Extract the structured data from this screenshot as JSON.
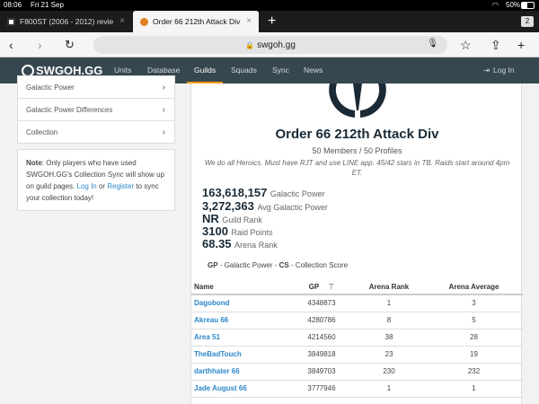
{
  "status": {
    "time": "08:06",
    "date": "Fri 21 Sep",
    "battery": "50%"
  },
  "tabs": [
    {
      "label": "F800ST (2006 - 2012) revie",
      "close": "×"
    },
    {
      "label": "Order 66 212th Attack Div",
      "close": "×"
    }
  ],
  "tab_count": "2",
  "new_tab": "+",
  "url": "swgoh.gg",
  "site": {
    "logo": "SWGOH.GG",
    "nav": [
      "Units",
      "Database",
      "Guilds",
      "Squads",
      "Sync",
      "News"
    ],
    "login": "Log In"
  },
  "sidebar": {
    "items": [
      "Galactic Power",
      "Galactic Power Differences",
      "Collection"
    ],
    "note": {
      "bold": "Note",
      "text1": ": Only players who have used SWGOH.GG's Collection Sync will show up on guild pages.",
      "login_link": "Log In",
      "or": "or",
      "register_link": "Register",
      "text2": "to sync your collection today!"
    }
  },
  "guild": {
    "name": "Order 66 212th Attack Div",
    "members": "50 Members / 50 Profiles",
    "description": "We do all Heroics. Must have RJT and use LINE app. 45/42 stars in TB. Raids start around 4pm ET.",
    "stats": [
      {
        "value": "163,618,157",
        "label": "Galactic Power"
      },
      {
        "value": "3,272,363",
        "label": "Avg Galactic Power"
      },
      {
        "value": "NR",
        "label": "Guild Rank"
      },
      {
        "value": "3100",
        "label": "Raid Points"
      },
      {
        "value": "68.35",
        "label": "Arena Rank"
      }
    ],
    "legend": {
      "gp": "GP",
      "gp_text": "- Galactic Power -",
      "cs": "CS",
      "cs_text": "- Collection Score"
    }
  },
  "table": {
    "headers": [
      "Name",
      "GP",
      "Arena Rank",
      "Arena Average"
    ],
    "rows": [
      [
        "Dagobond",
        "4348873",
        "1",
        "3"
      ],
      [
        "Akreau 66",
        "4280786",
        "8",
        "5"
      ],
      [
        "Area 51",
        "4214560",
        "38",
        "28"
      ],
      [
        "TheBadTouch",
        "3849818",
        "23",
        "19"
      ],
      [
        "darthhater 66",
        "3849703",
        "230",
        "232"
      ],
      [
        "Jade August 66",
        "3777946",
        "1",
        "1"
      ]
    ]
  }
}
